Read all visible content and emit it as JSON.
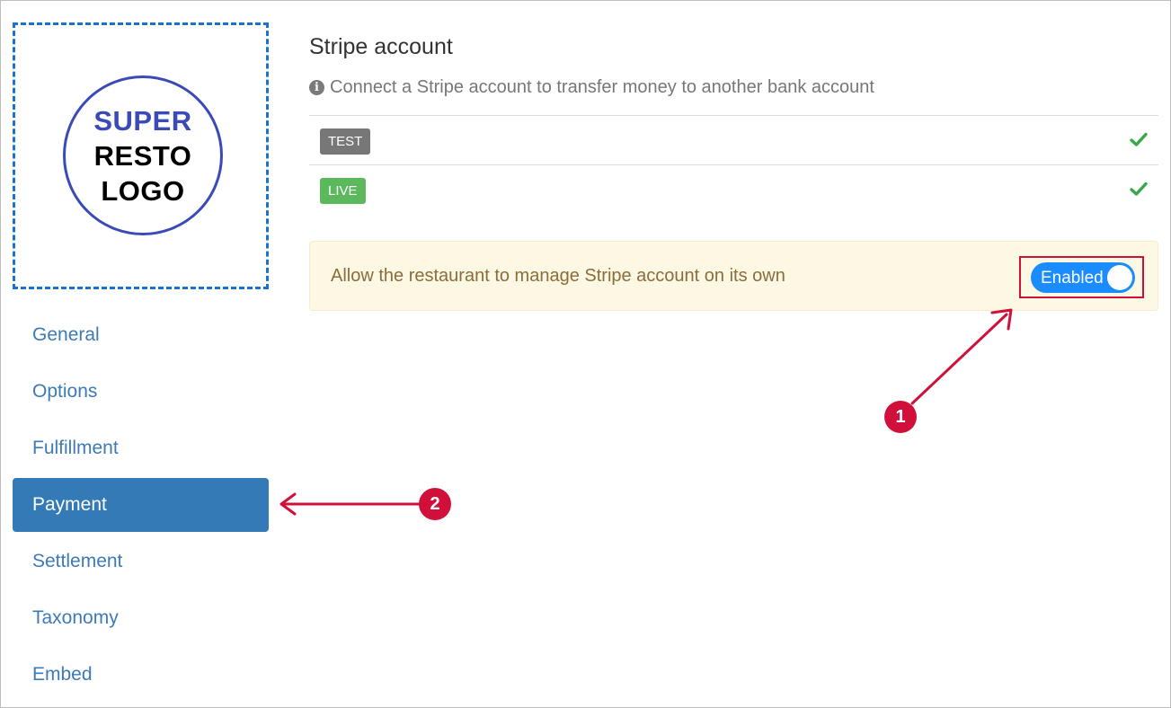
{
  "logo": {
    "line1": "SUPER",
    "line2": "RESTO",
    "line3": "LOGO"
  },
  "nav": {
    "items": [
      {
        "label": "General"
      },
      {
        "label": "Options"
      },
      {
        "label": "Fulfillment"
      },
      {
        "label": "Payment"
      },
      {
        "label": "Settlement"
      },
      {
        "label": "Taxonomy"
      },
      {
        "label": "Embed"
      }
    ],
    "active": "Payment"
  },
  "main": {
    "title": "Stripe account",
    "subtitle": "Connect a Stripe account to transfer money to another bank account",
    "accounts": [
      {
        "badge": "TEST",
        "connected_icon": "check-icon"
      },
      {
        "badge": "LIVE",
        "connected_icon": "check-icon"
      }
    ],
    "alert": {
      "text": "Allow the restaurant to manage Stripe account on its own",
      "toggle_label": "Enabled",
      "toggle_on": true
    }
  },
  "annotations": {
    "callout_1": "1",
    "callout_2": "2"
  },
  "colors": {
    "nav_active_bg": "#337ab7",
    "link": "#3d7ab8",
    "badge_test": "#777777",
    "badge_live": "#5cb85c",
    "alert_bg": "#fcf8e3",
    "toggle_on": "#1a8cff",
    "annotation": "#d0103a",
    "logo_blue": "#3a4bb8"
  }
}
